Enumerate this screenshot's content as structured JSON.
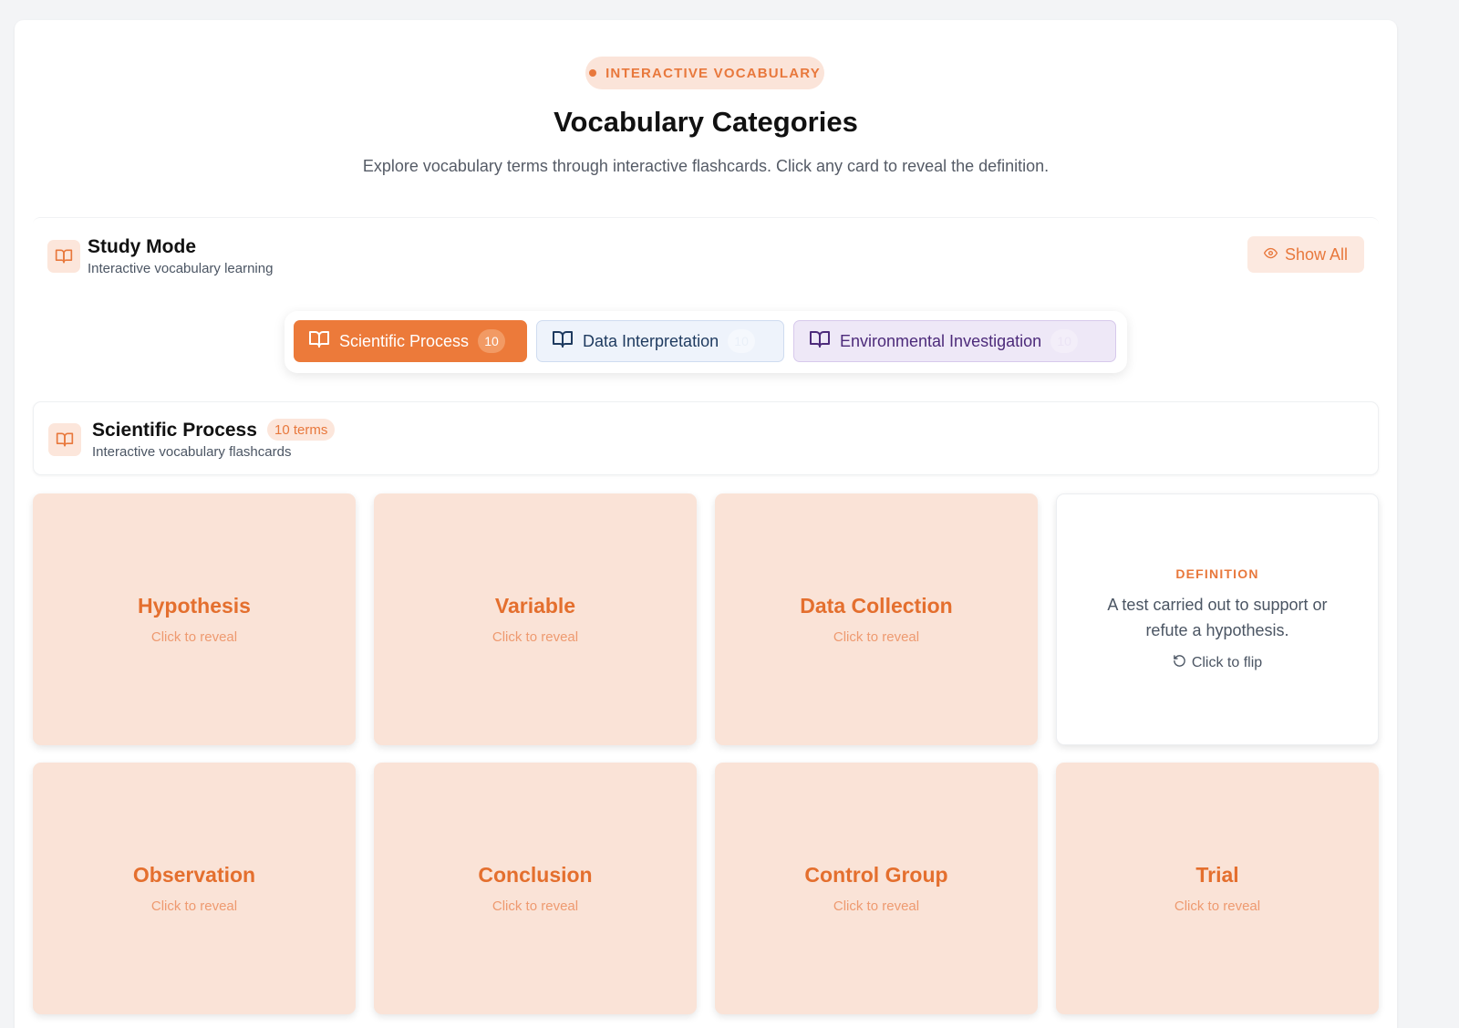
{
  "header": {
    "pill": "INTERACTIVE VOCABULARY",
    "title": "Vocabulary Categories",
    "subtitle": "Explore vocabulary terms through interactive flashcards. Click any card to reveal the definition."
  },
  "study_mode": {
    "title": "Study Mode",
    "subtitle": "Interactive vocabulary learning",
    "show_all": "Show All"
  },
  "tabs": [
    {
      "label": "Scientific Process",
      "count": "10"
    },
    {
      "label": "Data Interpretation",
      "count": "10"
    },
    {
      "label": "Environmental Investigation",
      "count": "10"
    }
  ],
  "category": {
    "title": "Scientific Process",
    "terms": "10 terms",
    "subtitle": "Interactive vocabulary flashcards"
  },
  "cards": [
    {
      "term": "Hypothesis",
      "hint": "Click to reveal"
    },
    {
      "term": "Variable",
      "hint": "Click to reveal"
    },
    {
      "term": "Data Collection",
      "hint": "Click to reveal"
    },
    {
      "label": "DEFINITION",
      "definition": "A test carried out to support or refute a hypothesis.",
      "hint": "Click to flip"
    },
    {
      "term": "Observation",
      "hint": "Click to reveal"
    },
    {
      "term": "Conclusion",
      "hint": "Click to reveal"
    },
    {
      "term": "Control Group",
      "hint": "Click to reveal"
    },
    {
      "term": "Trial",
      "hint": "Click to reveal"
    }
  ],
  "colors": {
    "accent": "#e8783c",
    "card_front": "#fae3d7",
    "tab_active": "#ec7a3a"
  }
}
